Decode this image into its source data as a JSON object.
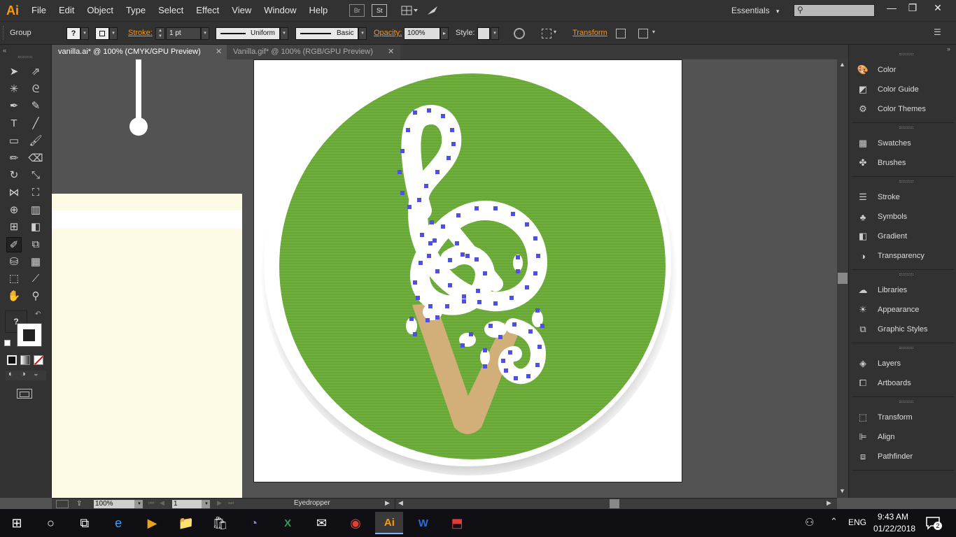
{
  "app": {
    "logo": "Ai",
    "accent": "#FF9A00"
  },
  "menu": [
    "File",
    "Edit",
    "Object",
    "Type",
    "Select",
    "Effect",
    "View",
    "Window",
    "Help"
  ],
  "menubar_icons": [
    "Br",
    "St"
  ],
  "workspace": {
    "label": "Essentials",
    "dropdown": "▾"
  },
  "window_controls": {
    "minimize": "—",
    "restore": "❐",
    "close": "✕"
  },
  "control_bar": {
    "selection_label": "Group",
    "stroke_label": "Stroke:",
    "stroke_weight": "1 pt",
    "profile": "Uniform",
    "brush": "Basic",
    "opacity_label": "Opacity:",
    "opacity_value": "100%",
    "style_label": "Style:",
    "transform_label": "Transform"
  },
  "tabs": [
    {
      "label": "vanilla.ai* @ 100% (CMYK/GPU Preview)",
      "close": "✕"
    },
    {
      "label": "Vanilla.gif* @ 100% (RGB/GPU Preview)",
      "close": "✕"
    }
  ],
  "toolbar": {
    "fill_question": "?",
    "tools": [
      "selection-icon",
      "direct-selection-icon",
      "magic-wand-icon",
      "lasso-icon",
      "pen-icon",
      "curvature-icon",
      "type-icon",
      "line-icon",
      "rectangle-icon",
      "paintbrush-icon",
      "pencil-icon",
      "eraser-icon",
      "rotate-icon",
      "scale-icon",
      "width-icon",
      "free-transform-icon",
      "shape-builder-icon",
      "chart-icon",
      "mesh-icon",
      "gradient-icon",
      "eyedropper-icon",
      "blend-icon",
      "symbol-sprayer-icon",
      "column-graph-icon",
      "artboard-icon",
      "slice-icon",
      "hand-icon",
      "zoom-icon"
    ]
  },
  "panels": {
    "groups": [
      [
        "Color",
        "Color Guide",
        "Color Themes"
      ],
      [
        "Swatches",
        "Brushes"
      ],
      [
        "Stroke",
        "Symbols",
        "Gradient",
        "Transparency"
      ],
      [
        "Libraries",
        "Appearance",
        "Graphic Styles"
      ],
      [
        "Layers",
        "Artboards"
      ],
      [
        "Transform",
        "Align",
        "Pathfinder"
      ]
    ]
  },
  "status_bar": {
    "zoom": "100%",
    "artboard": "1",
    "tool": "Eyedropper"
  },
  "artwork": {
    "circle_color": "#6FAF3C",
    "cone_color": "#D2AE78",
    "anchor_color": "#5050E0",
    "panel_color": "#FDFBE6"
  },
  "taskbar": {
    "language": "ENG",
    "time": "9:43 AM",
    "date": "01/22/2018",
    "notification_count": "2",
    "apps": [
      "windows-start-icon",
      "cortana-icon",
      "task-view-icon",
      "edge-icon",
      "media-icon",
      "file-explorer-icon",
      "store-icon",
      "eclipse-icon",
      "excel-icon",
      "mail-icon",
      "chrome-icon",
      "illustrator-icon",
      "word-icon",
      "pdf-icon"
    ]
  }
}
